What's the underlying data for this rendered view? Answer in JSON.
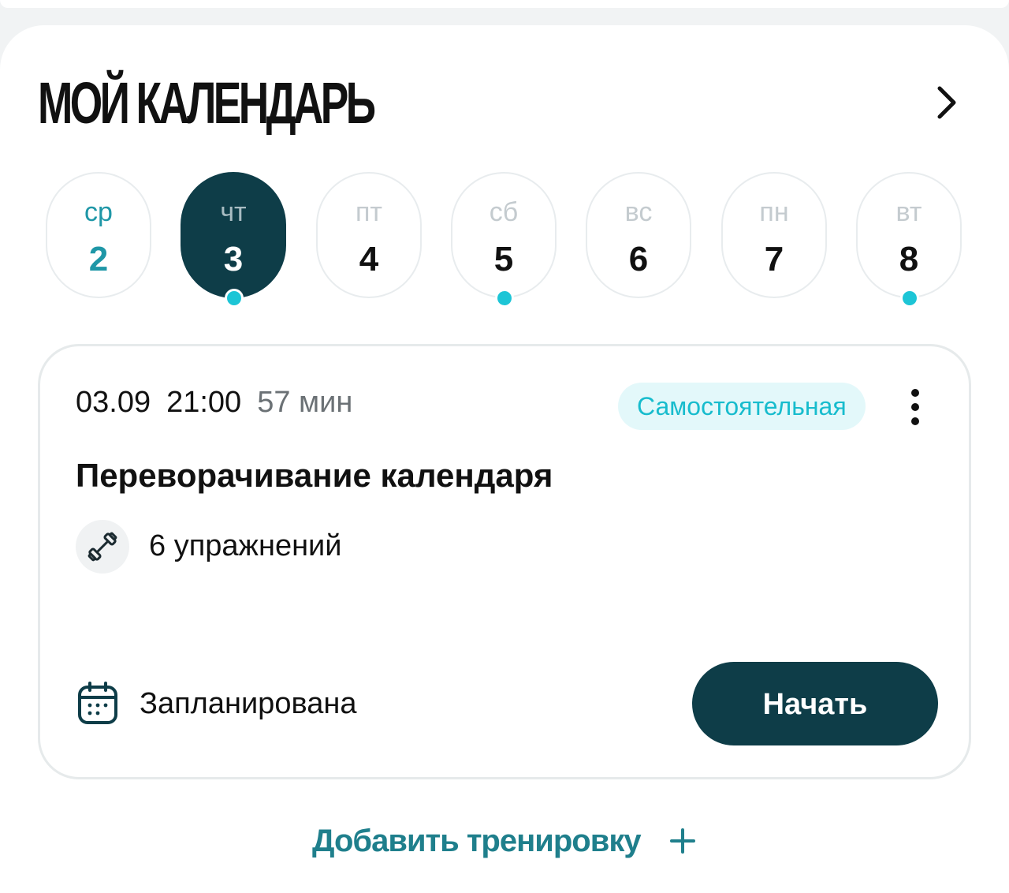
{
  "header": {
    "title": "МОЙ КАЛЕНДАРЬ",
    "chevron_icon": "chevron-right-icon"
  },
  "days": [
    {
      "name": "ср",
      "number": "2",
      "state": "today",
      "has_event": false
    },
    {
      "name": "чт",
      "number": "3",
      "state": "selected",
      "has_event": true
    },
    {
      "name": "пт",
      "number": "4",
      "state": "default",
      "has_event": false
    },
    {
      "name": "сб",
      "number": "5",
      "state": "default",
      "has_event": true
    },
    {
      "name": "вс",
      "number": "6",
      "state": "default",
      "has_event": false
    },
    {
      "name": "пн",
      "number": "7",
      "state": "default",
      "has_event": false
    },
    {
      "name": "вт",
      "number": "8",
      "state": "default",
      "has_event": true
    }
  ],
  "workout": {
    "date": "03.09",
    "time": "21:00",
    "duration": "57 мин",
    "badge": "Самостоятельная",
    "title": "Переворачивание календаря",
    "exercises_icon": "dumbbell-icon",
    "exercises": "6 упражнений",
    "status_icon": "calendar-icon",
    "status": "Запланирована",
    "start_label": "Начать",
    "menu_icon": "more-vertical-icon"
  },
  "add_workout": {
    "label": "Добавить тренировку",
    "icon": "plus-icon"
  },
  "colors": {
    "accent_dark": "#0e3d48",
    "accent_cyan": "#1dc5d6",
    "badge_bg": "#e3f8fa",
    "link": "#1f7f8c"
  }
}
